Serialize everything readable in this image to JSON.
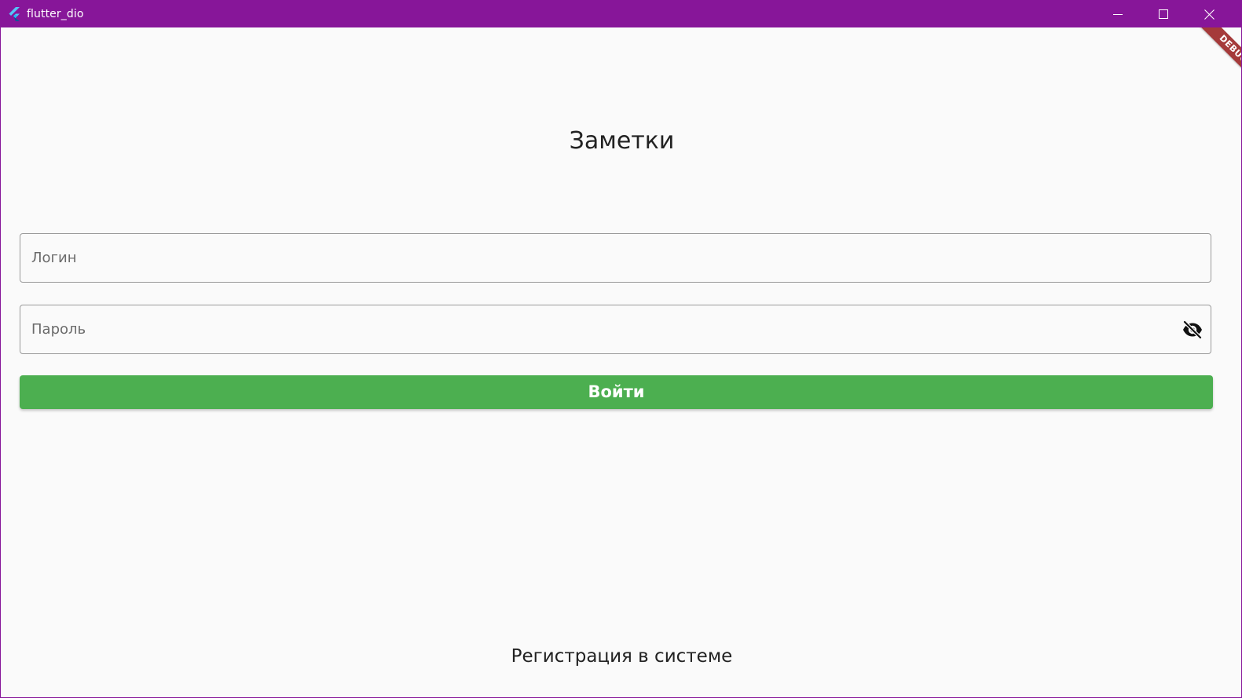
{
  "window": {
    "title": "flutter_dio",
    "icon": "flutter-logo-icon",
    "controls": {
      "minimize_icon": "minimize-icon",
      "maximize_icon": "maximize-icon",
      "close_icon": "close-icon"
    },
    "titlebar_color": "#871699"
  },
  "debug_banner": {
    "label": "DEBUG",
    "color": "#a53a3a"
  },
  "login_screen": {
    "title": "Заметки",
    "login_field": {
      "value": "",
      "placeholder": "Логин"
    },
    "password_field": {
      "value": "",
      "placeholder": "Пароль",
      "visibility_icon": "eye-off-icon"
    },
    "submit_button": {
      "label": "Войти",
      "color": "#4caf50"
    },
    "register_link": {
      "label": "Регистрация в системе"
    }
  }
}
